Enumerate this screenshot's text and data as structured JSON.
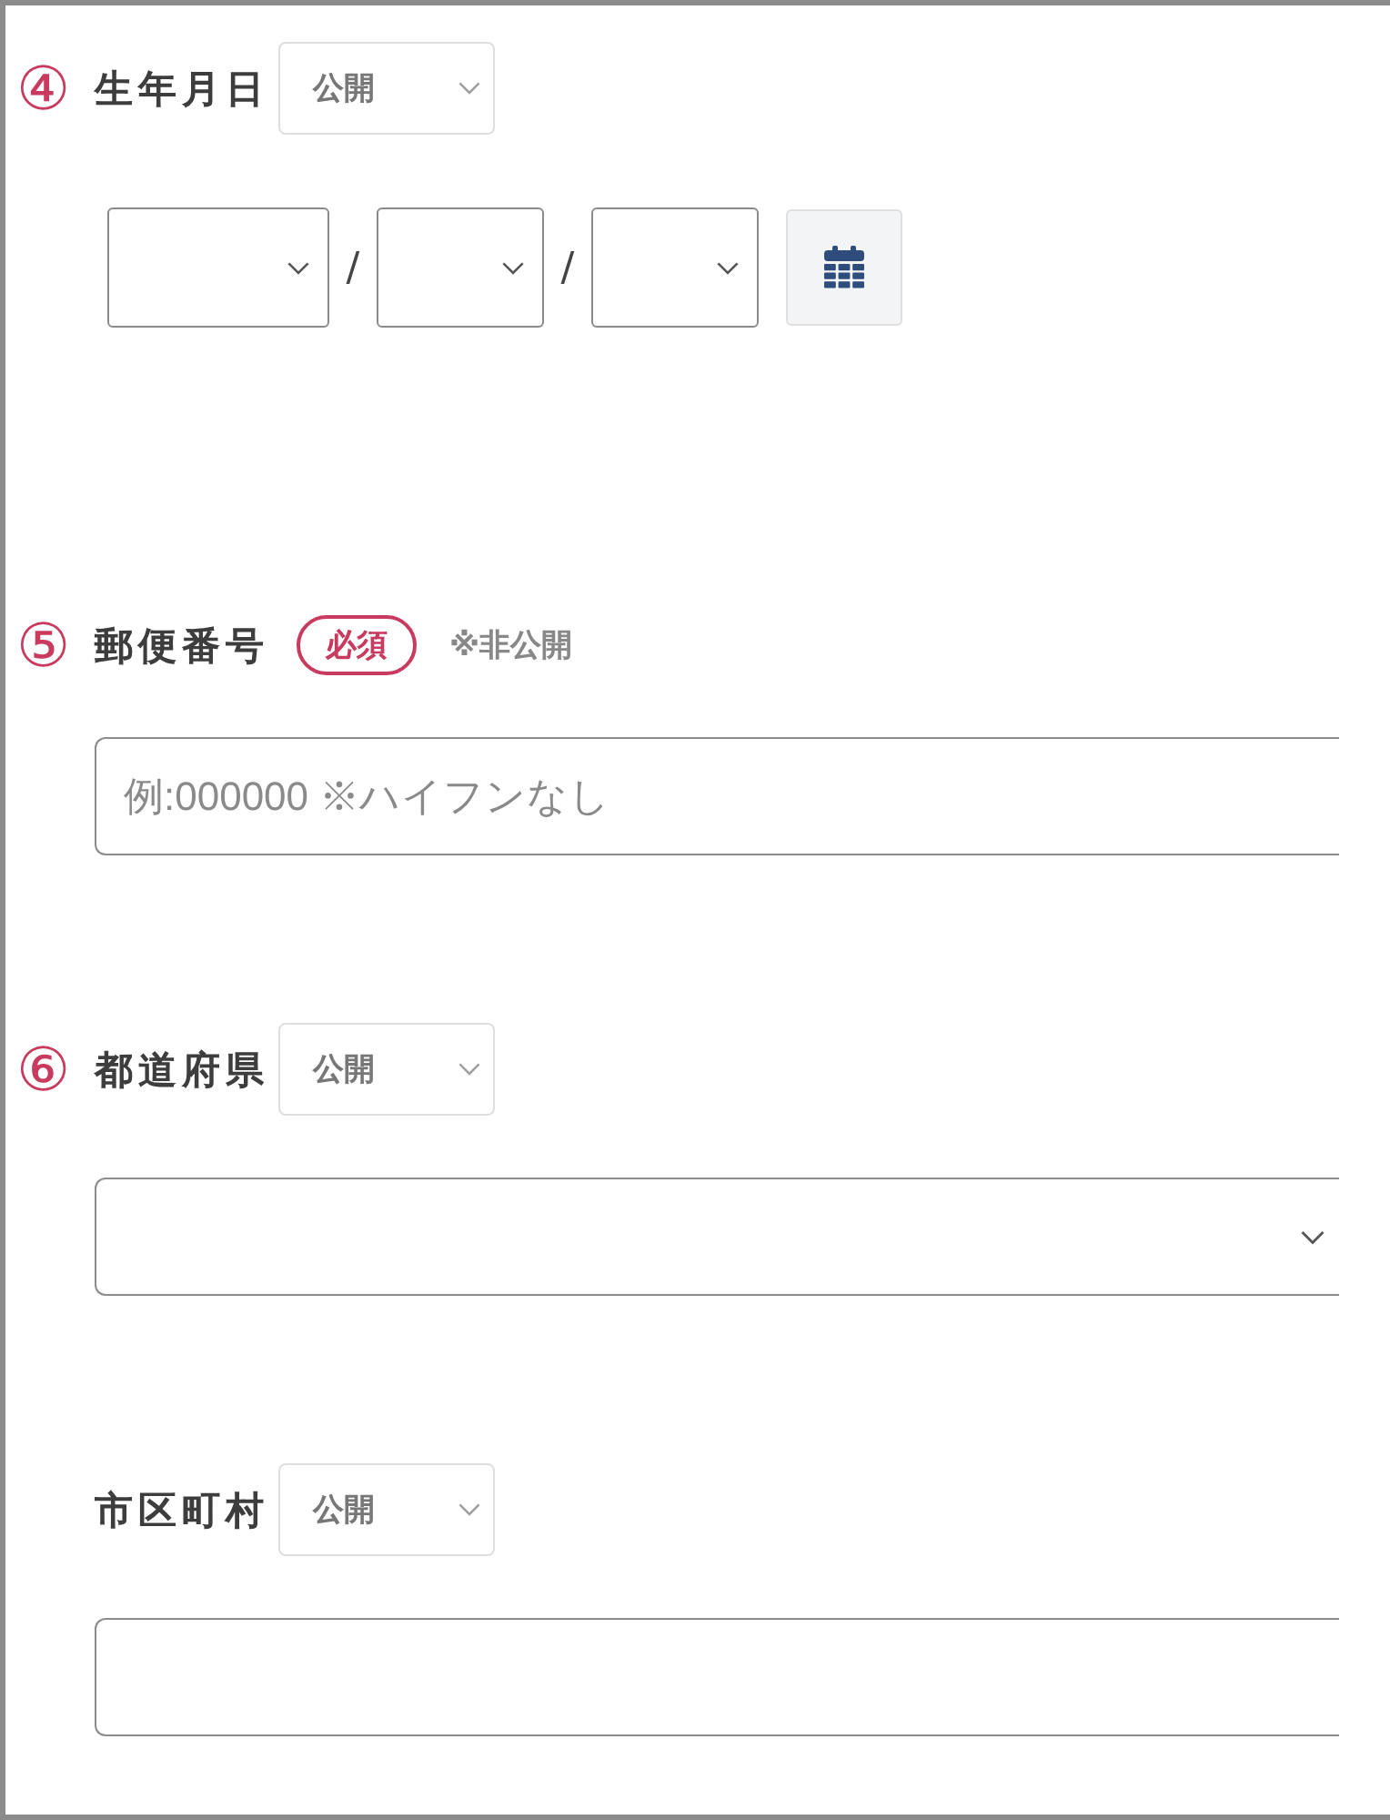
{
  "sections": [
    {
      "number": "④",
      "label": "生年月日",
      "visibility": "公開",
      "field": {
        "kind": "date",
        "separators": [
          "/",
          "/"
        ]
      }
    },
    {
      "number": "⑤",
      "label": "郵便番号",
      "required": "必須",
      "note": "※非公開",
      "field": {
        "kind": "text",
        "placeholder": "例:000000 ※ハイフンなし"
      }
    },
    {
      "number": "⑥",
      "label": "都道府県",
      "visibility": "公開",
      "field": {
        "kind": "select"
      }
    },
    {
      "label": "市区町村",
      "visibility": "公開",
      "field": {
        "kind": "text"
      }
    }
  ]
}
